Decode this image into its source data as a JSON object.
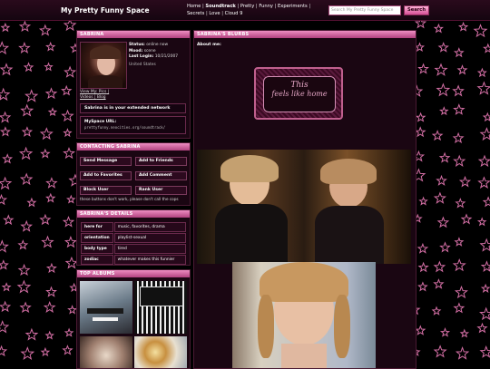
{
  "header": {
    "site_title": "My Pretty Funny Space",
    "nav": [
      "Home",
      "Soundtrack",
      "Pretty",
      "Funny",
      "Experiments",
      "Secrets",
      "Love",
      "Cloud 9"
    ],
    "search_placeholder": "Search My Pretty Funny Space",
    "search_button": "Search"
  },
  "profile": {
    "name_header": "SABRINA",
    "status_label": "Status:",
    "status_value": "online now",
    "mood_label": "Mood:",
    "mood_value": "scene",
    "login_label": "Last Login:",
    "login_value": "10/21/2007",
    "location": "United States",
    "view_label": "View My:",
    "pics_link": "Pics",
    "videos_link": "Videos",
    "blog_link": "Blog",
    "network_text": "Sabrina is in your extended network",
    "url_label": "MySpace URL:",
    "url_value": "prettyfunny.neocities.org/soundtrack/"
  },
  "contact": {
    "header": "CONTACTING SABRINA",
    "send_message": "Send Message",
    "add_friends": "Add to Friends",
    "add_favorites": "Add to Favorites",
    "add_comment": "Add Comment",
    "block_user": "Block User",
    "rank_user": "Rank User",
    "note": "these buttons don't work, please don't call the cops"
  },
  "details": {
    "header": "SABRINA'S DETAILS",
    "rows": [
      {
        "k": "here for",
        "v": "music, favorites, drama"
      },
      {
        "k": "orientation",
        "v": "playlist-sexual"
      },
      {
        "k": "body type",
        "v": "tired"
      },
      {
        "k": "zodiac",
        "v": "whatever makes this funnier"
      }
    ]
  },
  "albums": {
    "header": "TOP ALBUMS"
  },
  "blurbs": {
    "header": "SABRINA'S BLURBS",
    "about_label": "About me:",
    "banner_line1": "This",
    "banner_line2": "feels like home"
  },
  "colors": {
    "accent": "#d44f95",
    "header_gradient_top": "#ee8ec2",
    "star": "#d46fa5"
  }
}
